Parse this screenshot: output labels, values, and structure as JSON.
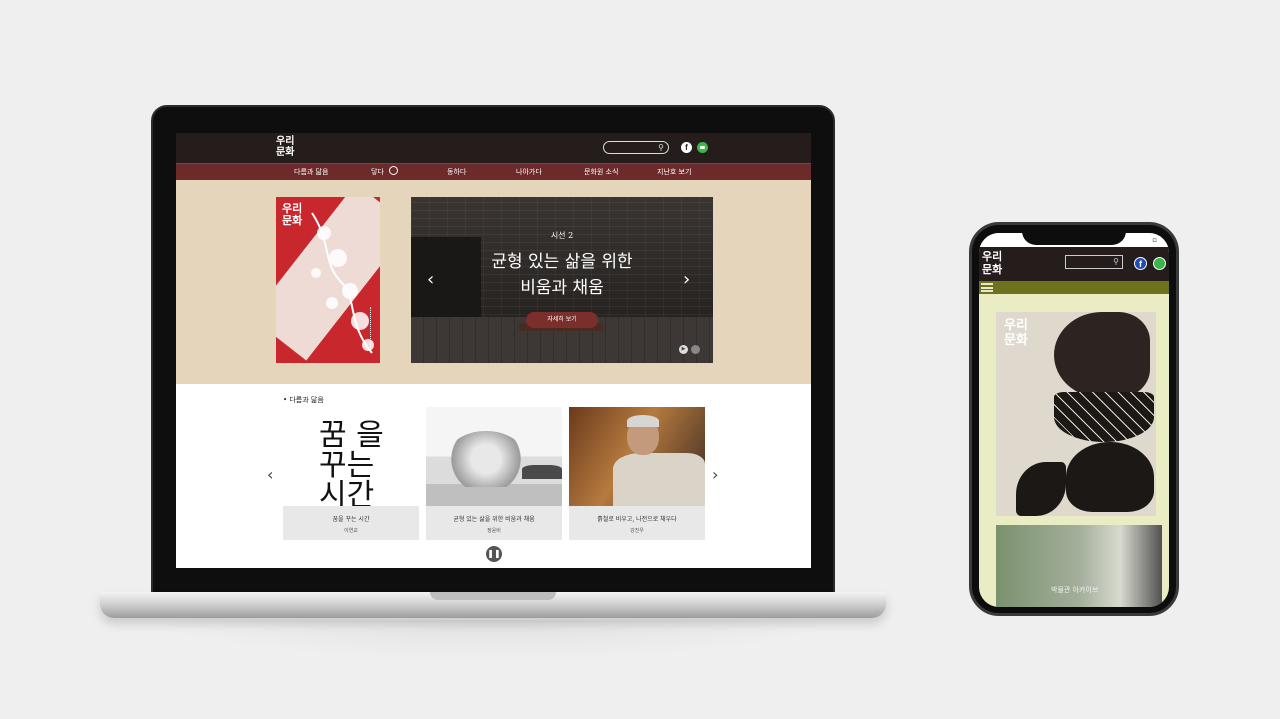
{
  "desktop": {
    "logo": [
      "우리",
      "문화"
    ],
    "nav": [
      "다름과 닮음",
      "닿다",
      "동하다",
      "나아가다",
      "문화원 소식",
      "지난호 보기"
    ],
    "hero": {
      "cover_title": [
        "우리",
        "문화"
      ],
      "kicker": "시선 2",
      "title_line1": "균형 있는 삶을 위한",
      "title_line2": "비움과 채움",
      "button": "자세히 보기",
      "prev_icon": "chevron-left",
      "next_icon": "chevron-right"
    },
    "section_title": "• 다름과 닮음",
    "cards": [
      {
        "title": "꿈을 꾸는 시간",
        "author": "이연교",
        "image_text": "꿈 을 꾸는 시간"
      },
      {
        "title": "균형 있는 삶을 위한 비움과 채움",
        "author": "정윤비"
      },
      {
        "title": "흙철로 비우고, 나전으로 채우다",
        "author": "강진우"
      }
    ]
  },
  "mobile": {
    "logo": [
      "우리",
      "문화"
    ],
    "cover_title": [
      "우리",
      "문화"
    ],
    "second_card_text": "박물관 아카이브"
  },
  "colors": {
    "header": "#241d1b",
    "nav": "#6d2a2a",
    "hero_band": "#e5d5ba",
    "mobile_bg": "#eaecc4",
    "mobile_nav": "#6e721f"
  }
}
